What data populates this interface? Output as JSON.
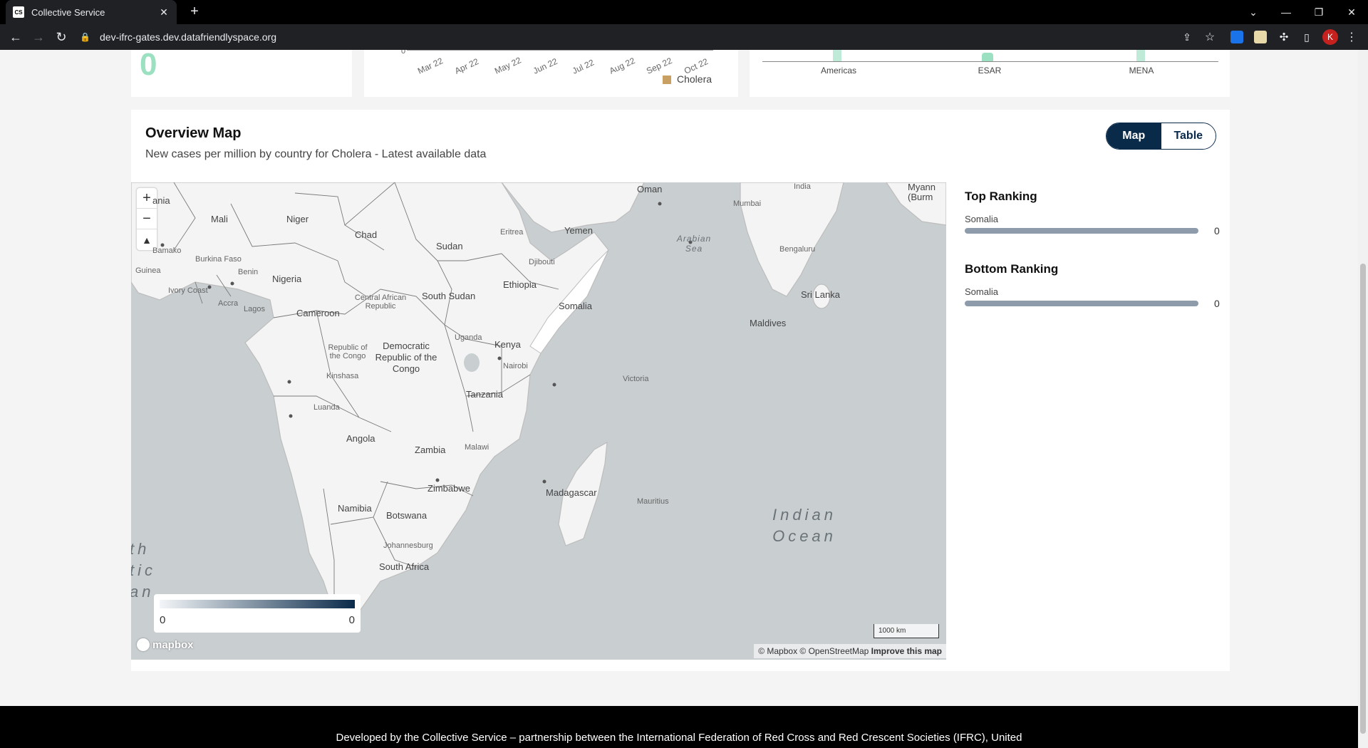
{
  "browser": {
    "tab_title": "Collective Service",
    "tab_favicon": "CS",
    "url": "dev-ifrc-gates.dev.datafriendlyspace.org",
    "avatar_letter": "K",
    "icons": [
      "back-arrow-icon",
      "forward-arrow-icon",
      "reload-icon",
      "lock-icon",
      "share-icon",
      "star-icon",
      "extensions-icon",
      "sidebar-icon",
      "menu-icon"
    ]
  },
  "top_cards": {
    "big_number": "0",
    "chart_y_zero": "0",
    "months": [
      "Mar 22",
      "Apr 22",
      "May 22",
      "Jun 22",
      "Jul 22",
      "Aug 22",
      "Sep 22",
      "Oct 22"
    ],
    "legend_label": "Cholera",
    "legend_color": "#c9a063",
    "regions": [
      "Americas",
      "ESAR",
      "MENA"
    ]
  },
  "overview": {
    "title": "Overview Map",
    "subtitle": "New cases per million by country for Cholera - Latest available data",
    "toggle": {
      "map": "Map",
      "table": "Table",
      "active": "map"
    }
  },
  "map": {
    "labels": {
      "mauritania": "ania",
      "mali": "Mali",
      "niger": "Niger",
      "chad": "Chad",
      "sudan": "Sudan",
      "eritrea": "Eritrea",
      "yemen": "Yemen",
      "oman": "Oman",
      "india": "India",
      "mumbai": "Mumbai",
      "myanmar": "Myann (Burm",
      "bamako": "Bamako",
      "burkina": "Burkina Faso",
      "guinea": "Guinea",
      "benin": "Benin",
      "nigeria": "Nigeria",
      "djibouti": "Djibouti",
      "ethiopia": "Ethiopia",
      "bengaluru": "Bengaluru",
      "ivory": "Ivory Coast",
      "accra": "Accra",
      "lagos": "Lagos",
      "car": "Central African Republic",
      "south_sudan": "South Sudan",
      "somalia": "Somalia",
      "cameroon": "Cameroon",
      "sri_lanka": "Sri Lanka",
      "maldives": "Maldives",
      "uganda": "Uganda",
      "kenya": "Kenya",
      "nairobi": "Nairobi",
      "roc": "Republic of the Congo",
      "drc": "Democratic Republic of the Congo",
      "kinshasa": "Kinshasa",
      "victoria": "Victoria",
      "tanzania": "Tanzania",
      "luanda": "Luanda",
      "angola": "Angola",
      "zambia": "Zambia",
      "malawi": "Malawi",
      "zimbabwe": "Zimbabwe",
      "madagascar": "Madagascar",
      "mauritius": "Mauritius",
      "namibia": "Namibia",
      "botswana": "Botswana",
      "johannesburg": "Johannesburg",
      "south_africa": "South Africa",
      "arabian_sea": "Arabian Sea",
      "indian_ocean": "Indian Ocean",
      "atlantic_partial": "th tic an"
    },
    "legend_min": "0",
    "legend_max": "0",
    "legend_colors": [
      "#f3f6f8",
      "#0a2a4a"
    ],
    "scale_label": "1000 km",
    "logo": "mapbox",
    "attribution": "© Mapbox © OpenStreetMap",
    "improve": "Improve this map",
    "zoom_in": "+",
    "zoom_out": "−",
    "compass": "▲"
  },
  "ranking": {
    "top_title": "Top Ranking",
    "top_country": "Somalia",
    "top_value": "0",
    "bottom_title": "Bottom Ranking",
    "bottom_country": "Somalia",
    "bottom_value": "0"
  },
  "footer": {
    "text": "Developed by the Collective Service – partnership between the International Federation of Red Cross and Red Crescent Societies (IFRC), United"
  }
}
